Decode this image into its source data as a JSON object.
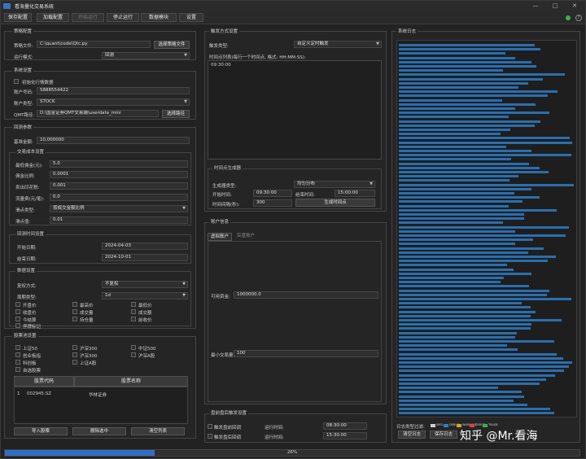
{
  "window": {
    "title": "看海量化交易系统"
  },
  "toolbar": {
    "save_config": "保存配置",
    "load_config": "加载配置",
    "start_run": "开始运行",
    "stop_run": "停止运行",
    "data_module": "数据模块",
    "settings": "设置"
  },
  "strategy": {
    "group": "策略配置",
    "file_label": "策略文件:",
    "file_value": "C:\\quant\\code\\Qtc.py",
    "select_file": "选择策略文件",
    "mode_label": "运行模式:",
    "mode_value": "回测"
  },
  "system": {
    "group": "系统设置",
    "init_trade_data": "初始化行情数据",
    "account_label": "账户号码:",
    "account_value": "5888554422",
    "type_label": "账户类型:",
    "type_value": "STOCK",
    "qmt_label": "QMT路径:",
    "qmt_value": "D:\\国金证券QMT交易端\\userdata_mini",
    "select_path": "选择路径"
  },
  "backtest": {
    "group": "回测参数",
    "capital_label": "基准金额:",
    "capital_value": "10,000000",
    "cost_group": "交易成本设置",
    "min_fee_label": "最低佣金(元):",
    "min_fee_value": "5.0",
    "commission_label": "佣金比例:",
    "commission_value": "0.0001",
    "stamp_label": "卖出印花税:",
    "stamp_value": "0.001",
    "flow_label": "流量费(元/笔):",
    "flow_value": "0.0",
    "slip_type_label": "滑点类型:",
    "slip_type_value": "按成交金额比例",
    "slip_label": "滑点值:",
    "slip_value": "0.01",
    "time_group": "回测时间设置",
    "start_label": "开始日期:",
    "start_value": "2024-04-03",
    "end_label": "结束日期:",
    "end_value": "2024-10-01",
    "data_group": "数据设置",
    "adjust_label": "复权方式:",
    "adjust_value": "不复权",
    "period_label": "周期类型:",
    "period_value": "1d",
    "fields": [
      "开盘价",
      "最高价",
      "最低价",
      "收盘价",
      "成交量",
      "成交额",
      "今结算",
      "持仓量",
      "前收价",
      "停牌标记"
    ]
  },
  "stock_pool": {
    "group": "股票池设置",
    "indexes": [
      "上证50",
      "沪深300",
      "中证500",
      "创业板指",
      "沪深300",
      "沪深A股",
      "科创板",
      "上证A股"
    ],
    "custom": "自选股票",
    "col_code": "股票代码",
    "col_name": "股票名称",
    "rows": [
      {
        "idx": "1",
        "code": "002945.SZ",
        "name": "华林证券"
      }
    ],
    "import_btn": "导入股票",
    "delete_btn": "删除选中",
    "clear_btn": "清空列表"
  },
  "trigger": {
    "group": "触发方式设置",
    "type_label": "触发类型:",
    "type_value": "自定义定时触发",
    "list_label": "时间点列表(每行一个时间点, 格式: HH:MM:SS):",
    "list_value": "09:30:00",
    "gen_group": "时间点生成器",
    "gen_type_label": "生成器类型:",
    "gen_type_value": "均匀分布",
    "start_label": "开始时间:",
    "start_value": "09:30:00",
    "end_label": "结束时间:",
    "end_value": "15:00:00",
    "interval_label": "时间间隔(秒):",
    "interval_value": "300",
    "gen_btn": "生成时间点"
  },
  "account_info": {
    "group": "账户信息",
    "tab_virtual": "虚拟账户",
    "tab_real": "实盘账户",
    "avail_label": "可用资金:",
    "avail_value": "1000000.0",
    "min_label": "最小交易量:",
    "min_value": "100"
  },
  "pre_post": {
    "group": "盘前盘后触发设置",
    "pre_label": "触发盘前回调",
    "pre_time_label": "运行时间:",
    "pre_time_value": "08:30:00",
    "post_label": "触发盘后回调",
    "post_time_label": "运行时间:",
    "post_time_value": "15:30:00"
  },
  "log": {
    "group": "系统日志",
    "level_label": "日志类型过滤:",
    "clear_btn": "清空日志",
    "save_btn": "保存日志",
    "levels": [
      "INFO",
      "DEBUG",
      "WARNING",
      "ERROR",
      "TRADE"
    ],
    "level_colors": [
      "#cfcfcf",
      "#2e7dc7",
      "#e0a020",
      "#e04040",
      "#3bb34a"
    ]
  },
  "progress": {
    "percent": 0.26,
    "label": "26%"
  },
  "watermark": "知乎 @Mr.看海"
}
